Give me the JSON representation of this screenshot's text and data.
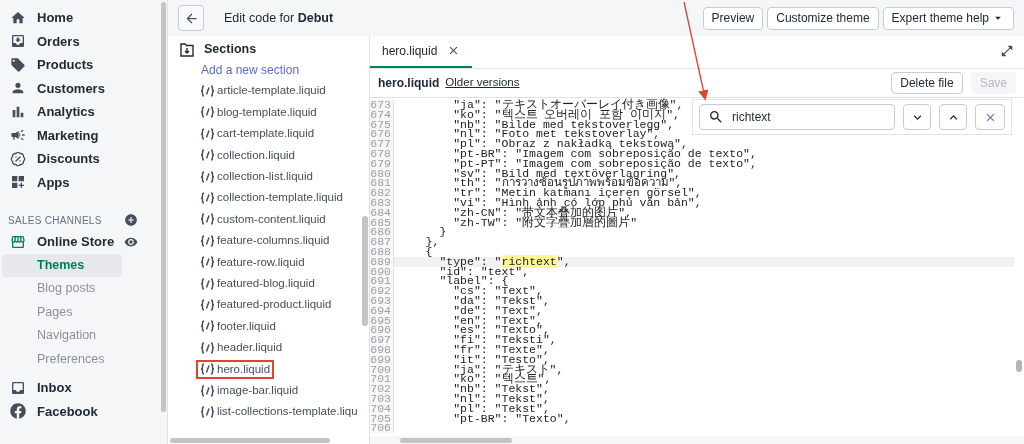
{
  "nav": {
    "items": [
      {
        "label": "Home",
        "selected": false
      },
      {
        "label": "Orders",
        "selected": false
      },
      {
        "label": "Products",
        "selected": false
      },
      {
        "label": "Customers",
        "selected": false
      },
      {
        "label": "Analytics",
        "selected": false
      },
      {
        "label": "Marketing",
        "selected": false
      },
      {
        "label": "Discounts",
        "selected": false
      },
      {
        "label": "Apps",
        "selected": false
      }
    ],
    "sales_channels": {
      "heading": "SALES CHANNELS",
      "channel": {
        "label": "Online Store",
        "expanded": true
      },
      "sub_items": [
        {
          "label": "Themes",
          "selected": true
        },
        {
          "label": "Blog posts",
          "selected": false
        },
        {
          "label": "Pages",
          "selected": false
        },
        {
          "label": "Navigation",
          "selected": false
        },
        {
          "label": "Preferences",
          "selected": false
        }
      ]
    },
    "bottom_items": [
      {
        "label": "Inbox"
      },
      {
        "label": "Facebook"
      }
    ]
  },
  "top_bar": {
    "title_prefix": "Edit code for",
    "theme": "Debut",
    "buttons": [
      {
        "label": "Preview",
        "dropdown": false
      },
      {
        "label": "Customize theme",
        "dropdown": false
      },
      {
        "label": "Expert theme help",
        "dropdown": true
      }
    ]
  },
  "files": {
    "folder": "Sections",
    "add_link": "Add a new section",
    "items": [
      {
        "name": "article-template.liquid",
        "highlighted": false
      },
      {
        "name": "blog-template.liquid",
        "highlighted": false
      },
      {
        "name": "cart-template.liquid",
        "highlighted": false
      },
      {
        "name": "collection.liquid",
        "highlighted": false
      },
      {
        "name": "collection-list.liquid",
        "highlighted": false
      },
      {
        "name": "collection-template.liquid",
        "highlighted": false
      },
      {
        "name": "custom-content.liquid",
        "highlighted": false
      },
      {
        "name": "feature-columns.liquid",
        "highlighted": false
      },
      {
        "name": "feature-row.liquid",
        "highlighted": false
      },
      {
        "name": "featured-blog.liquid",
        "highlighted": false
      },
      {
        "name": "featured-product.liquid",
        "highlighted": false
      },
      {
        "name": "footer.liquid",
        "highlighted": false
      },
      {
        "name": "header.liquid",
        "highlighted": false
      },
      {
        "name": "hero.liquid",
        "highlighted": true
      },
      {
        "name": "image-bar.liquid",
        "highlighted": false
      },
      {
        "name": "list-collections-template.liqu",
        "highlighted": false
      }
    ]
  },
  "editor": {
    "tabs": [
      {
        "label": "hero.liquid",
        "selected": true
      }
    ],
    "file_name": "hero.liquid",
    "older_versions": "Older versions",
    "buttons": [
      {
        "label": "Delete file",
        "disabled": false
      },
      {
        "label": "Save",
        "disabled": true
      }
    ],
    "search": {
      "value": "richtext"
    },
    "lines": [
      {
        "n": "673",
        "text": "        \"ja\": \"テキストオーバーレイ付き画像\",",
        "current": false
      },
      {
        "n": "674",
        "text": "        \"ko\": \"텍스트 오버레이 포함 이미지\",",
        "current": false
      },
      {
        "n": "675",
        "text": "        \"nb\": \"Bilde med tekstoverlegg\",",
        "current": false
      },
      {
        "n": "676",
        "text": "        \"nl\": \"Foto met tekstoverlay\",",
        "current": false
      },
      {
        "n": "677",
        "text": "        \"pl\": \"Obraz z nakładką tekstową\",",
        "current": false
      },
      {
        "n": "678",
        "text": "        \"pt-BR\": \"Imagem com sobreposição de texto\",",
        "current": false
      },
      {
        "n": "679",
        "text": "        \"pt-PT\": \"Imagem com sobreposição de texto\",",
        "current": false
      },
      {
        "n": "680",
        "text": "        \"sv\": \"Bild med textöverlagring\",",
        "current": false
      },
      {
        "n": "681",
        "text": "        \"th\": \"การวางซ้อนรูปภาพพร้อมข้อความ\",",
        "current": false
      },
      {
        "n": "682",
        "text": "        \"tr\": \"Metin katmanı içeren görsel\",",
        "current": false
      },
      {
        "n": "683",
        "text": "        \"vi\": \"Hình ảnh có lớp phủ văn bản\",",
        "current": false
      },
      {
        "n": "684",
        "text": "        \"zh-CN\": \"带文本叠加的图片\",",
        "current": false
      },
      {
        "n": "685",
        "text": "        \"zh-TW\": \"附文字疊加層的圖片\"",
        "current": false
      },
      {
        "n": "686",
        "text": "      }",
        "current": false
      },
      {
        "n": "687",
        "text": "    },",
        "current": false
      },
      {
        "n": "688",
        "text": "    {",
        "current": false
      },
      {
        "n": "689",
        "text": "      \"type\": \"",
        "match": "richtext",
        "after": "\",",
        "current": true
      },
      {
        "n": "690",
        "text": "      \"id\": \"text\",",
        "current": false
      },
      {
        "n": "691",
        "text": "      \"label\": {",
        "current": false
      },
      {
        "n": "692",
        "text": "        \"cs\": \"Text\",",
        "current": false
      },
      {
        "n": "693",
        "text": "        \"da\": \"Tekst\",",
        "current": false
      },
      {
        "n": "694",
        "text": "        \"de\": \"Text\",",
        "current": false
      },
      {
        "n": "695",
        "text": "        \"en\": \"Text\",",
        "current": false
      },
      {
        "n": "696",
        "text": "        \"es\": \"Texto\",",
        "current": false
      },
      {
        "n": "697",
        "text": "        \"fi\": \"Teksti\",",
        "current": false
      },
      {
        "n": "698",
        "text": "        \"fr\": \"Texte\",",
        "current": false
      },
      {
        "n": "699",
        "text": "        \"it\": \"Testo\",",
        "current": false
      },
      {
        "n": "700",
        "text": "        \"ja\": \"テキスト\",",
        "current": false
      },
      {
        "n": "701",
        "text": "        \"ko\": \"텍스트\",",
        "current": false
      },
      {
        "n": "702",
        "text": "        \"nb\": \"Tekst\",",
        "current": false
      },
      {
        "n": "703",
        "text": "        \"nl\": \"Tekst\",",
        "current": false
      },
      {
        "n": "704",
        "text": "        \"pl\": \"Tekst\",",
        "current": false
      },
      {
        "n": "705",
        "text": "        \"pt-BR\": \"Texto\",",
        "current": false
      },
      {
        "n": "706",
        "current": false
      }
    ]
  },
  "annotations": {
    "arrow": true
  }
}
